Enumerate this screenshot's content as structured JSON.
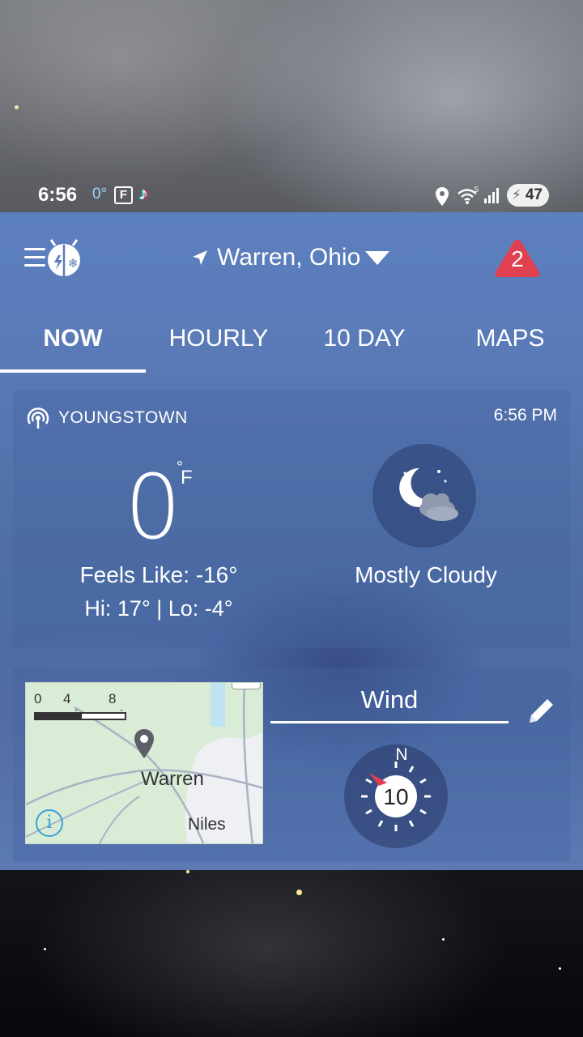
{
  "status_bar": {
    "time": "6:56",
    "temp": "0°",
    "f_badge": "F",
    "tiktok_glyph": "♪",
    "battery": "47",
    "icons": [
      "location-icon",
      "wifi-icon",
      "signal-icon",
      "battery-icon"
    ]
  },
  "header": {
    "location": "Warren, Ohio",
    "alert_count": "2",
    "accent_alert": "#e0404f"
  },
  "tabs": [
    {
      "label": "NOW",
      "active": true
    },
    {
      "label": "HOURLY",
      "active": false
    },
    {
      "label": "10 DAY",
      "active": false
    },
    {
      "label": "MAPS",
      "active": false
    }
  ],
  "current": {
    "station": "YOUNGSTOWN",
    "time": "6:56 PM",
    "temperature": "0",
    "degree_symbol": "°",
    "unit": "F",
    "feels_like": "Feels Like: -16°",
    "hi_lo": "Hi: 17° | Lo: -4°",
    "condition": "Mostly Cloudy",
    "condition_icon": "moon-cloud-icon"
  },
  "map": {
    "scale": [
      "0",
      "4 mi",
      "8 mi"
    ],
    "place_primary": "Warren",
    "place_secondary": "Niles"
  },
  "wind": {
    "title": "Wind",
    "direction_label": "N",
    "speed": "10"
  }
}
